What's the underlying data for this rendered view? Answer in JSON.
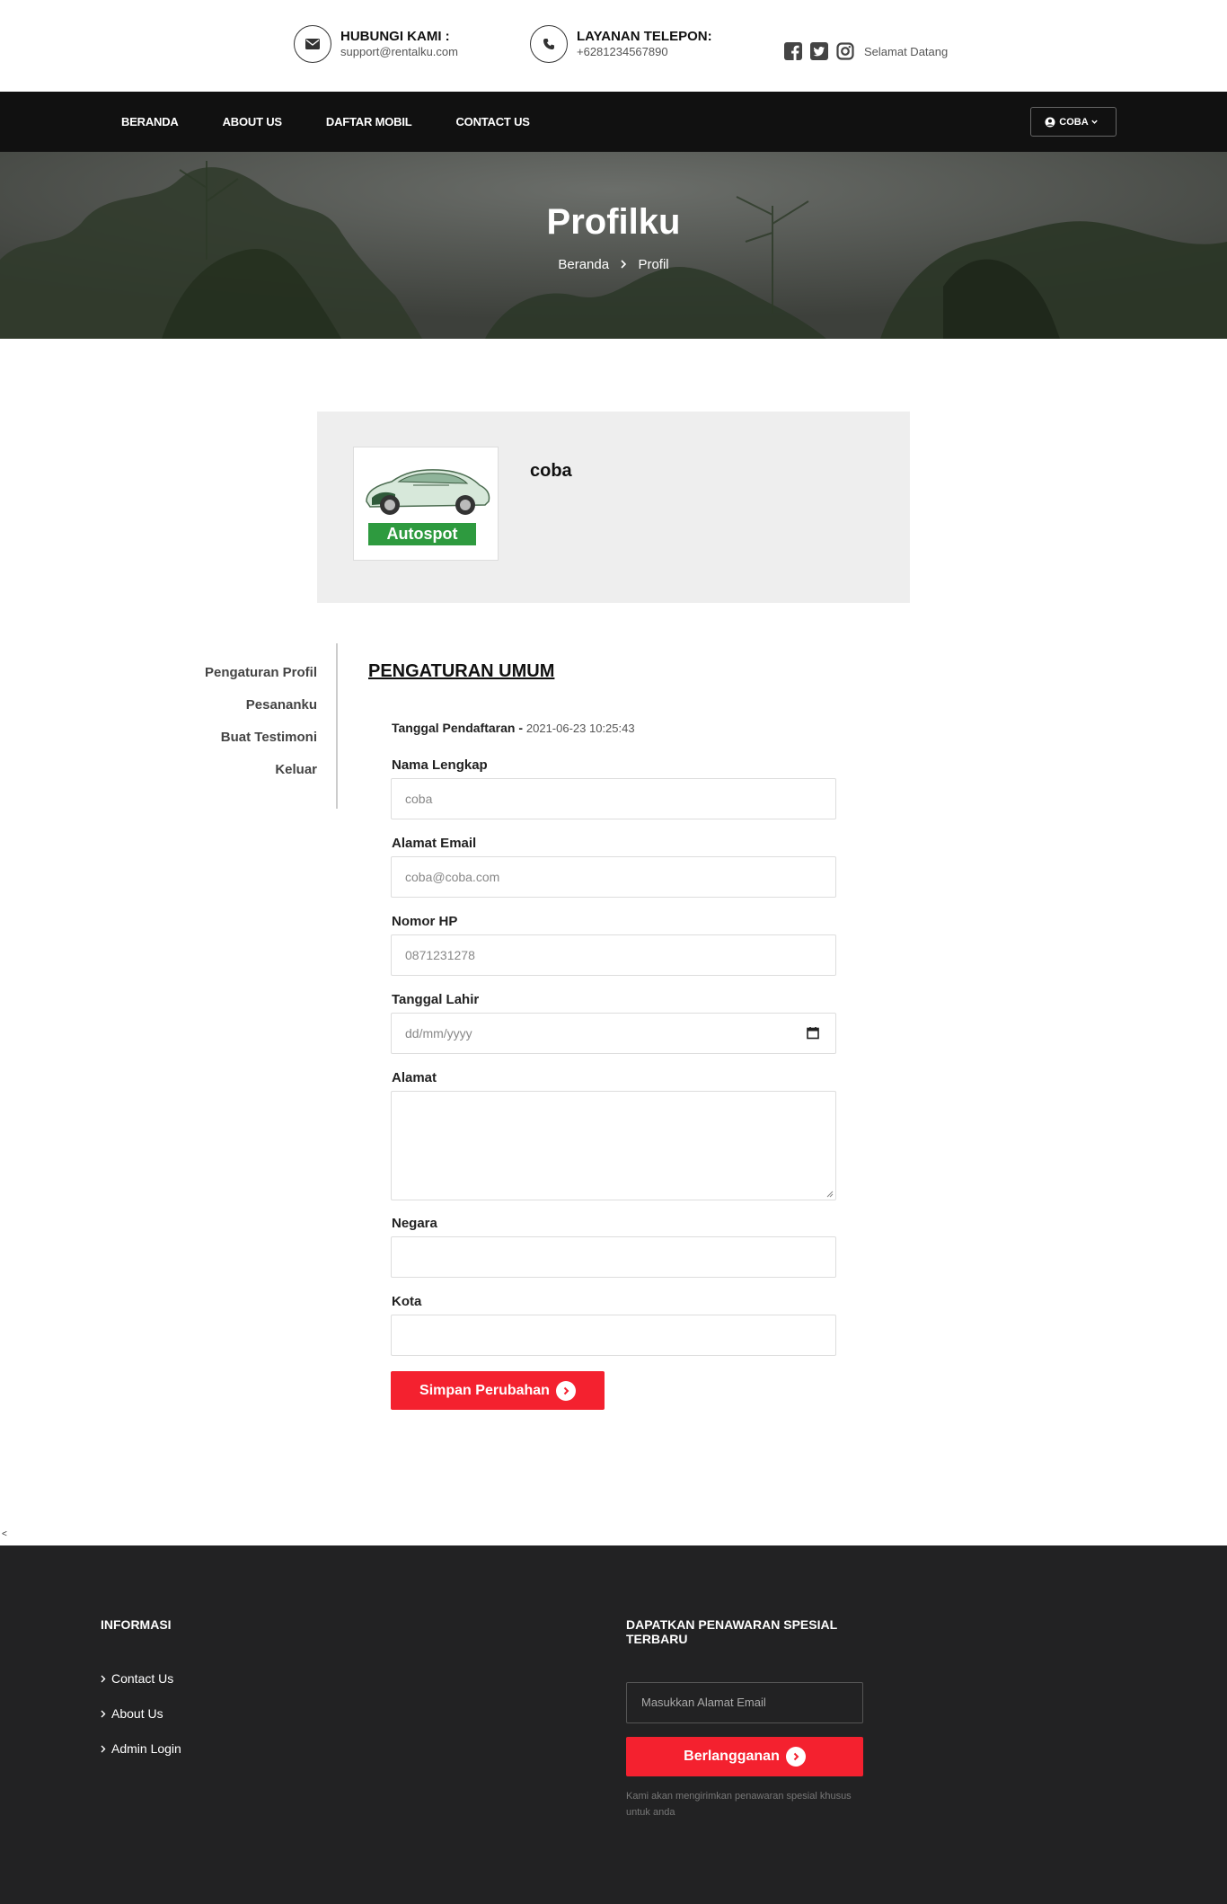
{
  "contact": {
    "email_title": "HUBUNGI KAMI :",
    "email_value": "support@rentalku.com",
    "phone_title": "LAYANAN TELEPON:",
    "phone_value": "+6281234567890",
    "welcome": "Selamat Datang"
  },
  "nav": {
    "items": [
      "BERANDA",
      "ABOUT US",
      "DAFTAR MOBIL",
      "CONTACT US"
    ],
    "user": "COBA"
  },
  "hero": {
    "title": "Profilku",
    "crumb_home": "Beranda",
    "crumb_current": "Profil"
  },
  "profile": {
    "logo_text": "Autospot",
    "username": "coba"
  },
  "side_menu": [
    "Pengaturan Profil",
    "Pesananku",
    "Buat Testimoni",
    "Keluar"
  ],
  "form": {
    "title": "PENGATURAN UMUM",
    "reg_label": "Tanggal Pendaftaran -",
    "reg_value": "2021-06-23 10:25:43",
    "name_label": "Nama Lengkap",
    "name_value": "coba",
    "email_label": "Alamat Email",
    "email_value": "coba@coba.com",
    "phone_label": "Nomor HP",
    "phone_value": "0871231278",
    "dob_label": "Tanggal Lahir",
    "dob_placeholder": "dd/mm/yyyy",
    "address_label": "Alamat",
    "country_label": "Negara",
    "city_label": "Kota",
    "save_label": "Simpan Perubahan"
  },
  "stray_char": "<",
  "footer": {
    "info_title": "INFORMASI",
    "links": [
      "Contact Us",
      "About Us",
      "Admin Login"
    ],
    "promo_title": "DAPATKAN PENAWARAN SPESIAL TERBARU",
    "email_placeholder": "Masukkan Alamat Email",
    "subscribe_label": "Berlangganan",
    "note": "Kami akan mengirimkan penawaran spesial khusus untuk anda"
  },
  "colors": {
    "accent": "#f4212f",
    "nav_bg": "#111111",
    "footer_bg": "#222223",
    "logo_green": "#2e9a3f"
  }
}
